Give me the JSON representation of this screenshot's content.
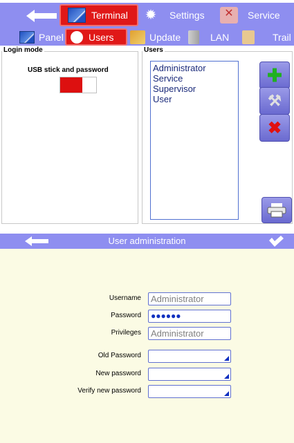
{
  "top_tabs": [
    {
      "label": "Terminal",
      "icon": "terminal-icon",
      "active": true
    },
    {
      "label": "Settings",
      "icon": "gear-icon",
      "active": false
    },
    {
      "label": "Service",
      "icon": "tools-icon",
      "active": false
    }
  ],
  "sub_tabs": [
    {
      "label": "Panel",
      "icon": "panel-icon",
      "active": false
    },
    {
      "label": "Users",
      "icon": "user-icon",
      "active": true
    },
    {
      "label": "Update",
      "icon": "update-icon",
      "active": false
    },
    {
      "label": "LAN",
      "icon": "lan-icon",
      "active": false
    },
    {
      "label": "Trail",
      "icon": "trail-icon",
      "active": false
    }
  ],
  "login_mode": {
    "group_title": "Login mode",
    "label": "USB stick and password",
    "toggle_on": true
  },
  "users": {
    "group_title": "Users",
    "items": [
      "Administrator",
      "Service",
      "Supervisor",
      "User"
    ]
  },
  "side_buttons": {
    "add": "plus-icon",
    "edit": "tools-icon",
    "delete": "x-icon",
    "print": "printer-icon"
  },
  "user_admin": {
    "title": "User administration",
    "fields": [
      {
        "label": "Username",
        "value": "Administrator",
        "type": "text"
      },
      {
        "label": "Password",
        "value": "●●●●●●",
        "type": "password"
      },
      {
        "label": "Privileges",
        "value": "Administrator",
        "type": "text"
      },
      {
        "label": "Old Password",
        "value": "",
        "type": "password-input"
      },
      {
        "label": "New password",
        "value": "",
        "type": "password-input"
      },
      {
        "label": "Verify new password",
        "value": "",
        "type": "password-input"
      }
    ]
  },
  "colors": {
    "accent": "#8e8ef0",
    "active_tab": "#e01818",
    "background_panel": "#fbfbe4",
    "field_border": "#6070d0"
  }
}
